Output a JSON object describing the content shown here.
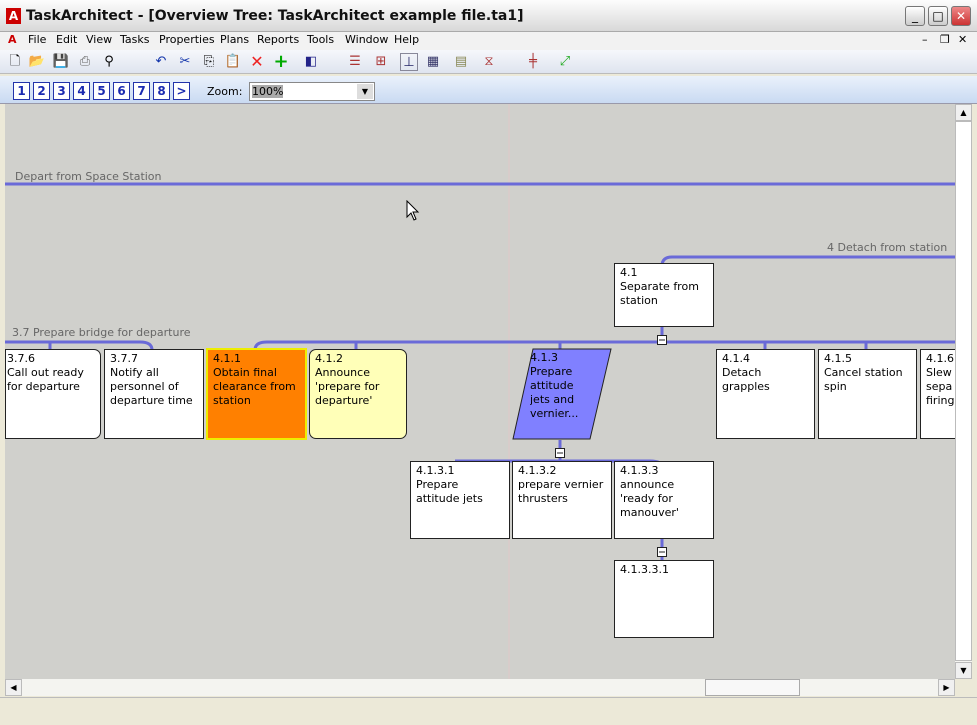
{
  "window": {
    "title": "TaskArchitect - [Overview Tree: TaskArchitect example file.ta1]",
    "controls": [
      "minimize",
      "maximize",
      "close"
    ]
  },
  "menu": [
    "File",
    "Edit",
    "View",
    "Tasks",
    "Properties",
    "Plans",
    "Reports",
    "Tools",
    "Window",
    "Help"
  ],
  "toolbar": [
    "new-icon",
    "open-icon",
    "save-icon",
    "print-icon",
    "find-icon",
    "undo-icon",
    "cut-icon",
    "copy-icon",
    "paste-icon",
    "delete-icon",
    "add-icon",
    "collapse-icon",
    "horizontal-tree-icon",
    "indented-tree-icon",
    "overview-tree-icon",
    "grid-tree-icon",
    "list-view-icon",
    "flow-icon",
    "timeline-icon",
    "plan-icon"
  ],
  "levels": [
    "1",
    "2",
    "3",
    "4",
    "5",
    "6",
    "7",
    "8",
    ">"
  ],
  "zoom": {
    "label": "Zoom:",
    "value": "100%"
  },
  "canvas": {
    "plan_labels": {
      "depart": "Depart from Space Station",
      "detach": "4 Detach from station",
      "bridge": "3.7 Prepare bridge for departure"
    },
    "nodes": [
      {
        "id": "3.7.6",
        "text": "Call out ready for departure"
      },
      {
        "id": "3.7.7",
        "text": "Notify all personnel of departure time"
      },
      {
        "id": "4.1.1",
        "text": "Obtain final clearance from station",
        "color": "#FF8000"
      },
      {
        "id": "4.1.2",
        "text": "Announce 'prepare for departure'",
        "color": "#FFFFB8"
      },
      {
        "id": "4.1.3",
        "text": "Prepare attitude jets and vernier...",
        "color": "#8080FF"
      },
      {
        "id": "4.1.4",
        "text": "Detach grapples"
      },
      {
        "id": "4.1.5",
        "text": "Cancel station spin"
      },
      {
        "id": "4.1.6",
        "text": "Slew sepa firing"
      },
      {
        "id": "4.1",
        "text": "Separate from station"
      },
      {
        "id": "4.1.3.1",
        "text": "Prepare attitude jets"
      },
      {
        "id": "4.1.3.2",
        "text": "prepare vernier thrusters"
      },
      {
        "id": "4.1.3.3",
        "text": "announce 'ready for manouver'"
      },
      {
        "id": "4.1.3.3.1",
        "text": ""
      }
    ]
  }
}
